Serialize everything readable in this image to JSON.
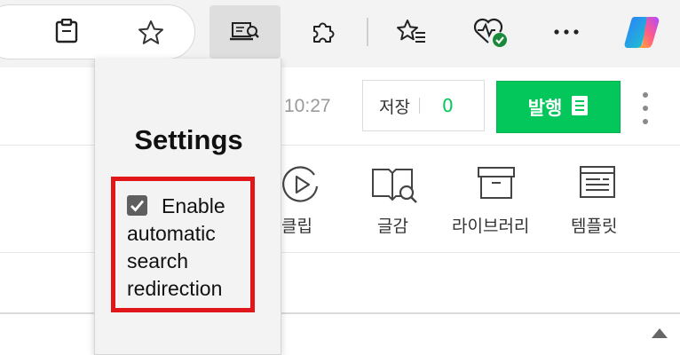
{
  "browser": {
    "toolbar_icons": [
      "clipboard-icon",
      "favorite-star-icon",
      "extension-search-icon",
      "extensions-puzzle-icon",
      "favorites-list-icon",
      "browser-health-icon",
      "more-icon",
      "copilot-icon"
    ]
  },
  "editor": {
    "time": "10:27",
    "save_label": "저장",
    "save_count": "0",
    "publish_label": "발행",
    "tools": [
      {
        "label": "﻿클립",
        "icon": "clip-play-icon"
      },
      {
        "label": "글감",
        "icon": "book-search-icon"
      },
      {
        "label": "라이브러리",
        "icon": "archive-box-icon"
      },
      {
        "label": "템플릿",
        "icon": "template-icon"
      }
    ]
  },
  "settings_popup": {
    "title": "Settings",
    "option_label": "Enable automatic search redirection",
    "option_checked": true,
    "highlight_color": "#e0161b"
  },
  "colors": {
    "accent_green": "#03c75a",
    "active_extension_bg": "#dedede"
  }
}
